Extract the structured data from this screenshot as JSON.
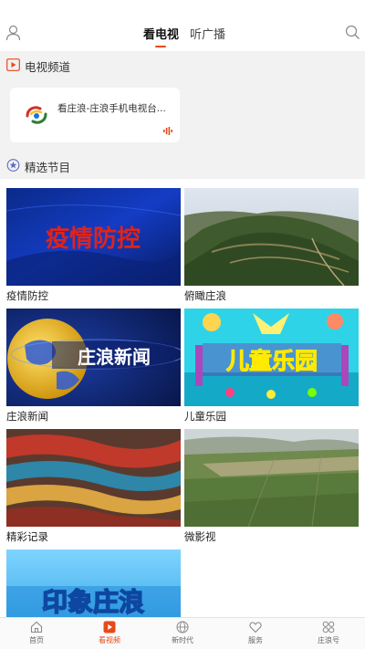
{
  "header": {
    "tabs": [
      {
        "label": "看电视",
        "active": true
      },
      {
        "label": "听广播",
        "active": false
      }
    ],
    "user_icon": "user-icon",
    "search_icon": "search-icon",
    "accent_color": "#e64a19"
  },
  "tv_section": {
    "title": "电视频道",
    "channel": {
      "name": "看庄浪-庄浪手机电视台...",
      "logo_icon": "station-logo"
    }
  },
  "featured_section": {
    "title": "精选节目",
    "programs": [
      {
        "label": "疫情防控",
        "overlay": "疫情防控"
      },
      {
        "label": "俯瞰庄浪",
        "overlay": ""
      },
      {
        "label": "庄浪新闻",
        "overlay": "庄浪新闻"
      },
      {
        "label": "儿童乐园",
        "overlay": "儿童乐园"
      },
      {
        "label": "精彩记录",
        "overlay": ""
      },
      {
        "label": "微影视",
        "overlay": ""
      },
      {
        "label": "",
        "overlay": "印象庄浪"
      }
    ]
  },
  "bottom_nav": {
    "items": [
      {
        "label": "首页",
        "icon": "home-icon",
        "active": false
      },
      {
        "label": "看视频",
        "icon": "video-icon",
        "active": true
      },
      {
        "label": "新时代",
        "icon": "globe-icon",
        "active": false
      },
      {
        "label": "服务",
        "icon": "heart-icon",
        "active": false
      },
      {
        "label": "庄浪号",
        "icon": "grid-icon",
        "active": false
      }
    ]
  }
}
